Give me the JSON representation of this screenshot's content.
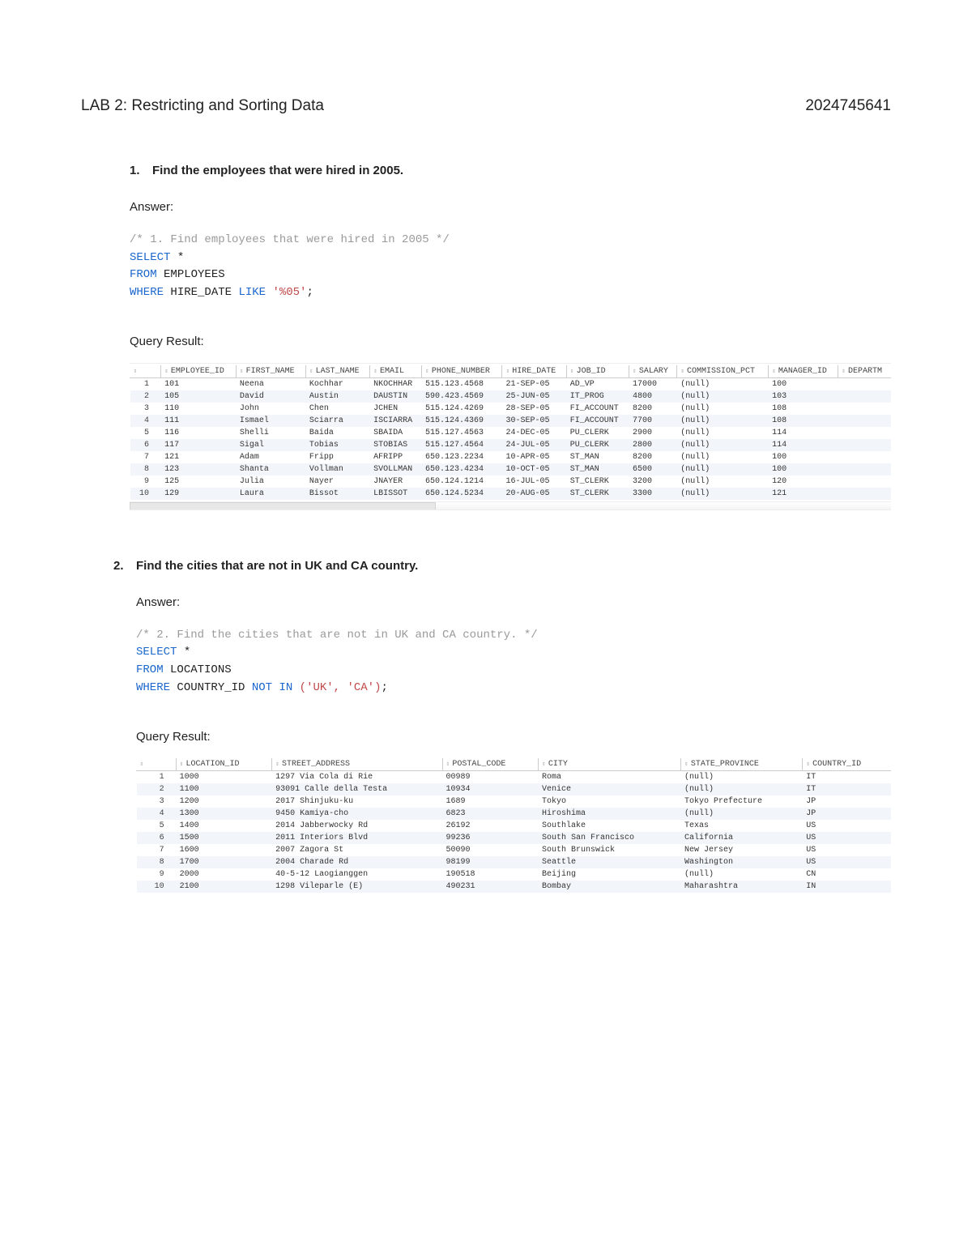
{
  "header": {
    "title": "LAB 2: Restricting and Sorting Data",
    "student_id": "2024745641"
  },
  "q1": {
    "number": "1.",
    "prompt": "Find the employees that were hired in 2005.",
    "answer_label": "Answer:",
    "sql": {
      "comment": "/* 1. Find employees that were hired in 2005 */",
      "line1": {
        "kw1": "SELECT",
        "rest": " *"
      },
      "line2": {
        "kw1": "FROM",
        "rest": " EMPLOYEES"
      },
      "line3": {
        "kw1": "WHERE",
        "mid": " HIRE_DATE ",
        "kw2": "LIKE",
        "str": " '%05'",
        "end": ";"
      }
    },
    "result_label": "Query Result:",
    "columns": [
      "",
      "EMPLOYEE_ID",
      "FIRST_NAME",
      "LAST_NAME",
      "EMAIL",
      "PHONE_NUMBER",
      "HIRE_DATE",
      "JOB_ID",
      "SALARY",
      "COMMISSION_PCT",
      "MANAGER_ID",
      "DEPARTM"
    ],
    "rows": [
      [
        "1",
        "101",
        "Neena",
        "Kochhar",
        "NKOCHHAR",
        "515.123.4568",
        "21-SEP-05",
        "AD_VP",
        "17000",
        "(null)",
        "100",
        ""
      ],
      [
        "2",
        "105",
        "David",
        "Austin",
        "DAUSTIN",
        "590.423.4569",
        "25-JUN-05",
        "IT_PROG",
        "4800",
        "(null)",
        "103",
        ""
      ],
      [
        "3",
        "110",
        "John",
        "Chen",
        "JCHEN",
        "515.124.4269",
        "28-SEP-05",
        "FI_ACCOUNT",
        "8200",
        "(null)",
        "108",
        ""
      ],
      [
        "4",
        "111",
        "Ismael",
        "Sciarra",
        "ISCIARRA",
        "515.124.4369",
        "30-SEP-05",
        "FI_ACCOUNT",
        "7700",
        "(null)",
        "108",
        ""
      ],
      [
        "5",
        "116",
        "Shelli",
        "Baida",
        "SBAIDA",
        "515.127.4563",
        "24-DEC-05",
        "PU_CLERK",
        "2900",
        "(null)",
        "114",
        ""
      ],
      [
        "6",
        "117",
        "Sigal",
        "Tobias",
        "STOBIAS",
        "515.127.4564",
        "24-JUL-05",
        "PU_CLERK",
        "2800",
        "(null)",
        "114",
        ""
      ],
      [
        "7",
        "121",
        "Adam",
        "Fripp",
        "AFRIPP",
        "650.123.2234",
        "10-APR-05",
        "ST_MAN",
        "8200",
        "(null)",
        "100",
        ""
      ],
      [
        "8",
        "123",
        "Shanta",
        "Vollman",
        "SVOLLMAN",
        "650.123.4234",
        "10-OCT-05",
        "ST_MAN",
        "6500",
        "(null)",
        "100",
        ""
      ],
      [
        "9",
        "125",
        "Julia",
        "Nayer",
        "JNAYER",
        "650.124.1214",
        "16-JUL-05",
        "ST_CLERK",
        "3200",
        "(null)",
        "120",
        ""
      ],
      [
        "10",
        "129",
        "Laura",
        "Bissot",
        "LBISSOT",
        "650.124.5234",
        "20-AUG-05",
        "ST_CLERK",
        "3300",
        "(null)",
        "121",
        ""
      ]
    ]
  },
  "q2": {
    "number": "2.",
    "prompt": "Find the cities that are not in UK and CA country.",
    "answer_label": "Answer:",
    "sql": {
      "comment": "/* 2. Find the cities that are not in UK and CA country. */",
      "line1": {
        "kw1": "SELECT",
        "rest": " *"
      },
      "line2": {
        "kw1": "FROM",
        "rest": " LOCATIONS"
      },
      "line3": {
        "kw1": "WHERE",
        "mid": " COUNTRY_ID ",
        "kw2": "NOT IN",
        "str": " ('UK', 'CA')",
        "end": ";"
      }
    },
    "result_label": "Query Result:",
    "columns": [
      "",
      "LOCATION_ID",
      "STREET_ADDRESS",
      "POSTAL_CODE",
      "CITY",
      "STATE_PROVINCE",
      "COUNTRY_ID"
    ],
    "rows": [
      [
        "1",
        "1000",
        "1297 Via Cola di Rie",
        "00989",
        "Roma",
        "(null)",
        "IT"
      ],
      [
        "2",
        "1100",
        "93091 Calle della Testa",
        "10934",
        "Venice",
        "(null)",
        "IT"
      ],
      [
        "3",
        "1200",
        "2017 Shinjuku-ku",
        "1689",
        "Tokyo",
        "Tokyo Prefecture",
        "JP"
      ],
      [
        "4",
        "1300",
        "9450 Kamiya-cho",
        "6823",
        "Hiroshima",
        "(null)",
        "JP"
      ],
      [
        "5",
        "1400",
        "2014 Jabberwocky Rd",
        "26192",
        "Southlake",
        "Texas",
        "US"
      ],
      [
        "6",
        "1500",
        "2011 Interiors Blvd",
        "99236",
        "South San Francisco",
        "California",
        "US"
      ],
      [
        "7",
        "1600",
        "2007 Zagora St",
        "50090",
        "South Brunswick",
        "New Jersey",
        "US"
      ],
      [
        "8",
        "1700",
        "2004 Charade Rd",
        "98199",
        "Seattle",
        "Washington",
        "US"
      ],
      [
        "9",
        "2000",
        "40-5-12 Laogianggen",
        "190518",
        "Beijing",
        "(null)",
        "CN"
      ],
      [
        "10",
        "2100",
        "1298 Vileparle (E)",
        "490231",
        "Bombay",
        "Maharashtra",
        "IN"
      ]
    ]
  }
}
